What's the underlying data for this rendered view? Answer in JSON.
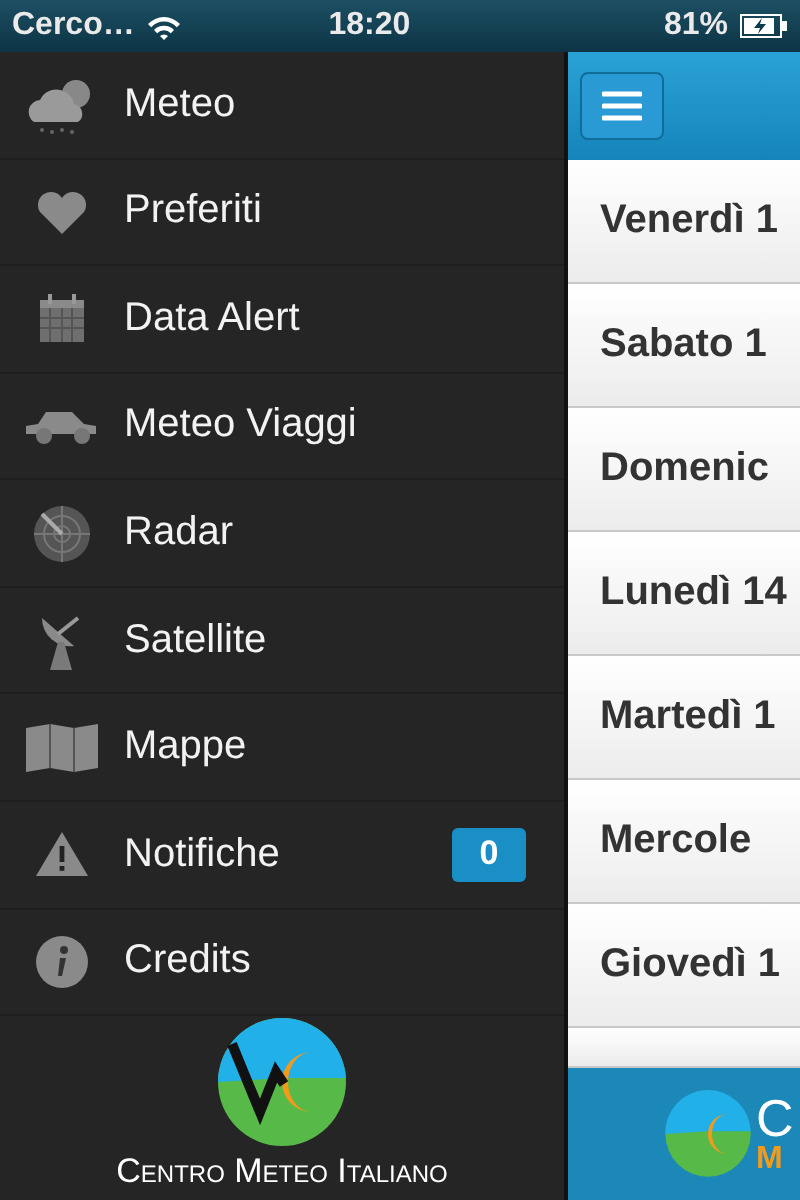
{
  "status_bar": {
    "carrier": "Cerco…",
    "time": "18:20",
    "battery": "81%"
  },
  "sidebar": {
    "items": [
      {
        "label": "Meteo"
      },
      {
        "label": "Preferiti"
      },
      {
        "label": "Data Alert"
      },
      {
        "label": "Meteo Viaggi"
      },
      {
        "label": "Radar"
      },
      {
        "label": "Satellite"
      },
      {
        "label": "Mappe"
      },
      {
        "label": "Notifiche",
        "badge": "0"
      },
      {
        "label": "Credits"
      }
    ],
    "logo_text": "Centro Meteo Italiano"
  },
  "days": [
    "Venerdì 1",
    "Sabato 1",
    "Domenic",
    "Lunedì 14",
    "Martedì 1",
    "Mercole",
    "Giovedì 1"
  ],
  "banner": {
    "letter_1": "C",
    "letter_2": "M"
  }
}
